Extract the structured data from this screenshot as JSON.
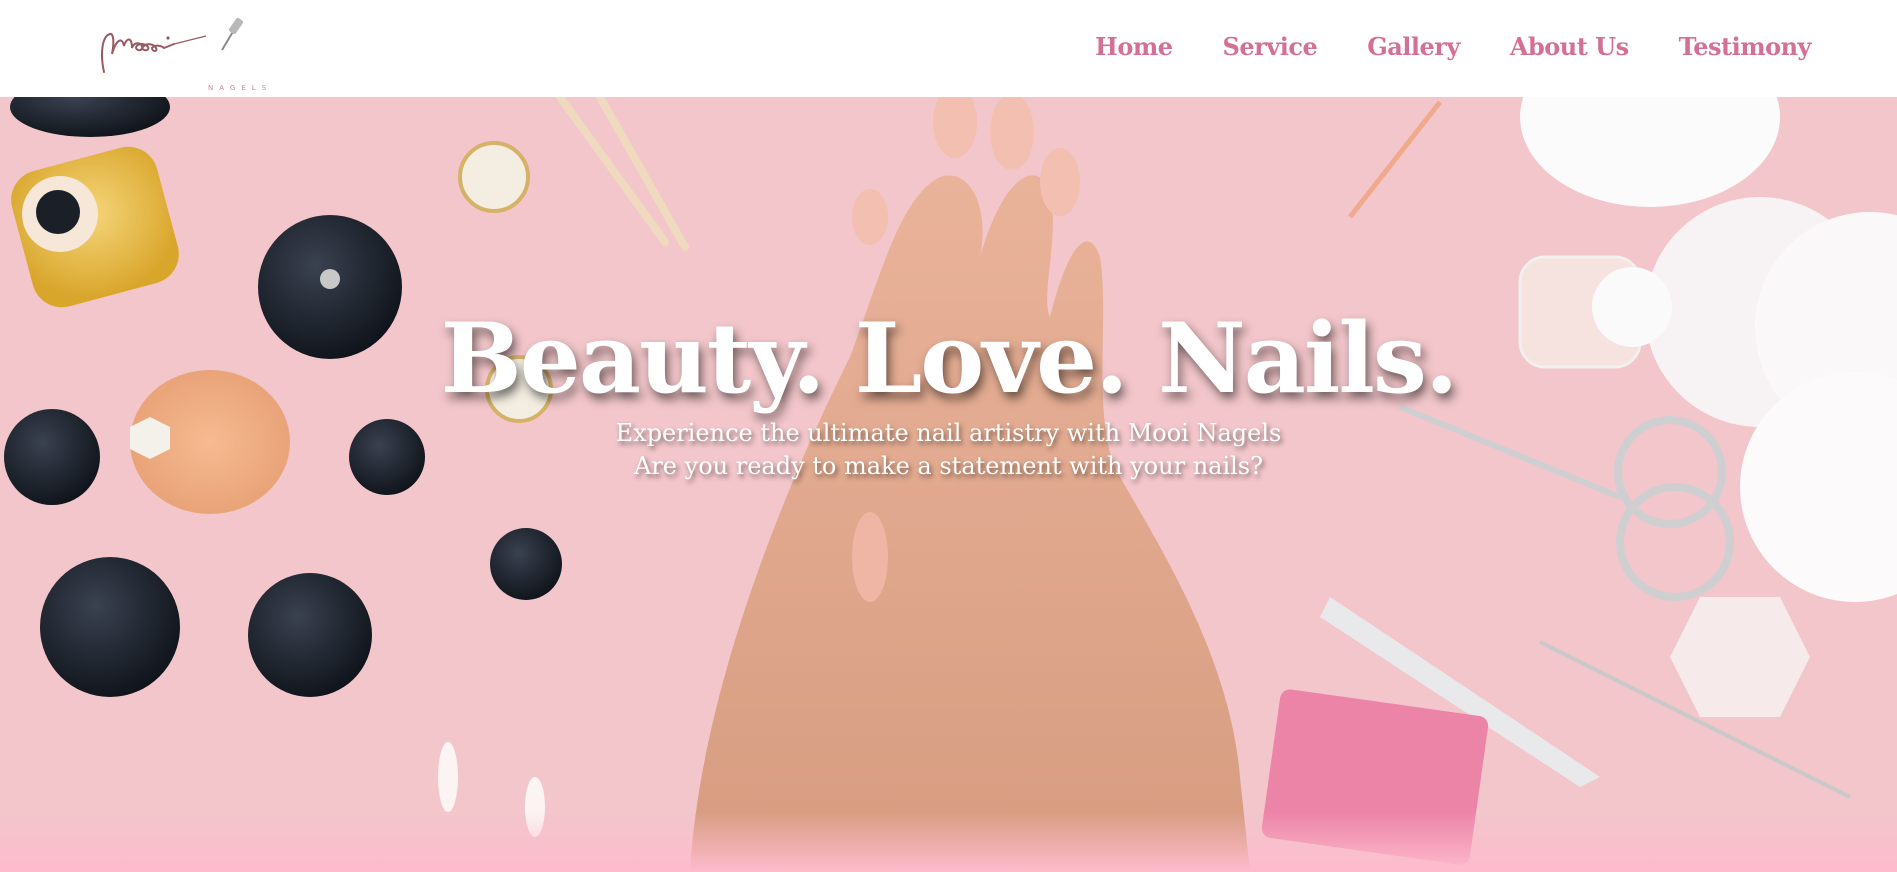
{
  "brand": {
    "logo_text": "Mooi",
    "logo_subtext": "NAGELS"
  },
  "nav": {
    "items": [
      {
        "label": "Home"
      },
      {
        "label": "Service"
      },
      {
        "label": "Gallery"
      },
      {
        "label": "About Us"
      },
      {
        "label": "Testimony"
      }
    ]
  },
  "hero": {
    "title": "Beauty. Love. Nails.",
    "subtitle_line1": "Experience the ultimate nail artistry with Mooi Nagels",
    "subtitle_line2": "Are you ready to make a statement with your nails?"
  },
  "colors": {
    "accent": "#d46f95",
    "hero_bg": "#f2c5c9",
    "band": "#fdbbcd"
  },
  "icons": {
    "logo_brush": "nail-polish-brush-icon"
  }
}
